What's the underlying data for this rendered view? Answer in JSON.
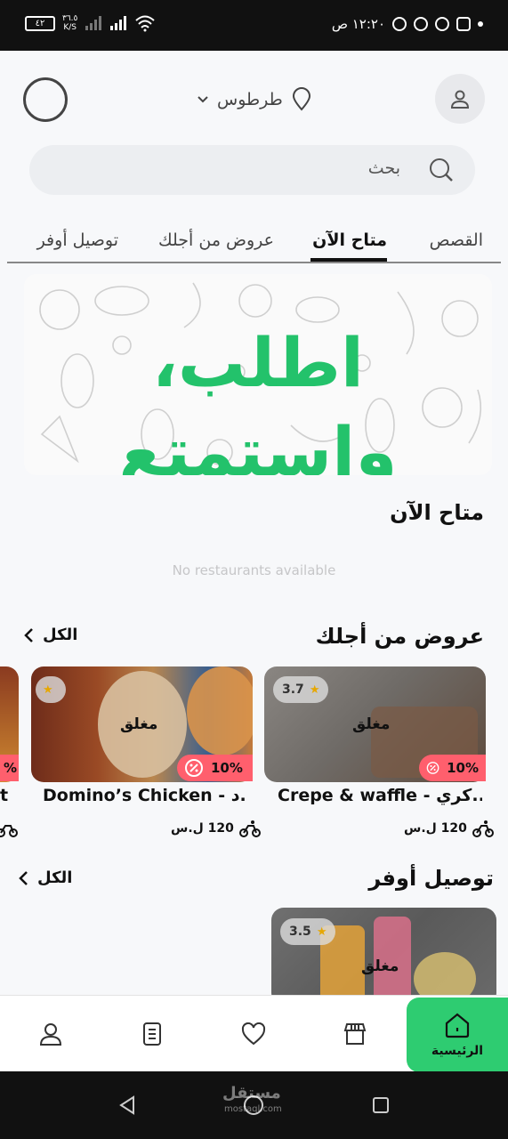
{
  "status_bar": {
    "time": "١٢:٢٠ ص",
    "battery": "٤٢",
    "net_speed_value": "٣٦.٥",
    "net_speed_unit": "K/S"
  },
  "header": {
    "location": "طرطوس"
  },
  "search": {
    "placeholder": "بحث"
  },
  "tabs": [
    {
      "label": "القصص"
    },
    {
      "label": "متاح الآن",
      "active": true
    },
    {
      "label": "عروض من أجلك"
    },
    {
      "label": "توصيل أوفر"
    }
  ],
  "banner": {
    "text": "اطلب، واستمتع"
  },
  "available_now": {
    "title": "متاح الآن",
    "empty_message": "No restaurants available"
  },
  "offers": {
    "title": "عروض من أجلك",
    "see_all": "الكل",
    "cards": [
      {
        "name": "Crepe & waffle - كري..",
        "rating": "3.7",
        "status": "مغلق",
        "discount": "10%",
        "fee": "120 ل.س"
      },
      {
        "name": "Domino’s Chicken - د...",
        "rating": "",
        "status": "مغلق",
        "discount": "10%",
        "fee": "120 ل.س"
      },
      {
        "name": "t",
        "discount": "%"
      }
    ]
  },
  "saver_delivery": {
    "title": "توصيل أوفر",
    "see_all": "الكل",
    "cards": [
      {
        "rating": "3.5",
        "status": "مغلق"
      }
    ]
  },
  "bottom_nav": {
    "home_label": "الرئيسية"
  },
  "watermark": {
    "main": "مستقل",
    "sub": "mostaql.com"
  },
  "colors": {
    "accent_green": "#2ecc71",
    "banner_green": "#23c26b",
    "discount_red": "#ff5f6d"
  }
}
